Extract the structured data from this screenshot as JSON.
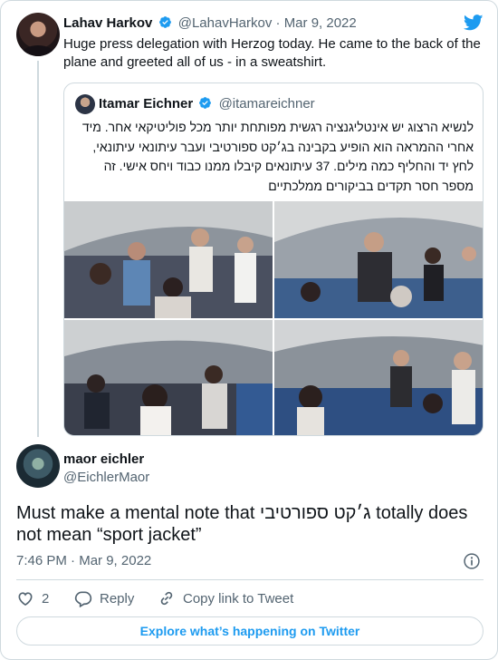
{
  "tweet": {
    "author_name": "Lahav Harkov",
    "author_handle": "@LahavHarkov",
    "date_sep": "·",
    "date": "Mar 9, 2022",
    "text": "Huge press delegation with Herzog today. He came to the back of the plane and greeted all of us - in a sweatshirt."
  },
  "quoted": {
    "author_name": "Itamar Eichner",
    "author_handle": "@itamareichner",
    "text": "לנשיא הרצוג יש אינטליגנציה רגשית מפותחת יותר מכל פוליטיקאי אחר. מיד אחרי ההמראה הוא הופיע בקבינה בג׳קט ספורטיבי ועבר עיתונאי עיתונאי, לחץ יד והחליף כמה מילים. 37 עיתונאים קיבלו ממנו כבוד ויחס אישי. זה מספר חסר תקדים בביקורים ממלכתיים"
  },
  "reply": {
    "author_name": "maor eichler",
    "author_handle": "@EichlerMaor",
    "text": "Must make a mental note that ג׳קט ספורטיבי totally does not mean “sport jacket”",
    "time": "7:46 PM",
    "sep": "·",
    "date": "Mar 9, 2022"
  },
  "actions": {
    "like_count": "2",
    "reply_label": "Reply",
    "copy_label": "Copy link to Tweet"
  },
  "footer": {
    "explore_label": "Explore what’s happening on Twitter"
  },
  "colors": {
    "accent": "#1d9bf0",
    "secondary_text": "#536471",
    "border": "#cfd9de"
  },
  "icons": [
    "verified-badge-icon",
    "twitter-bird-icon",
    "info-icon",
    "heart-icon",
    "reply-icon",
    "link-icon"
  ]
}
